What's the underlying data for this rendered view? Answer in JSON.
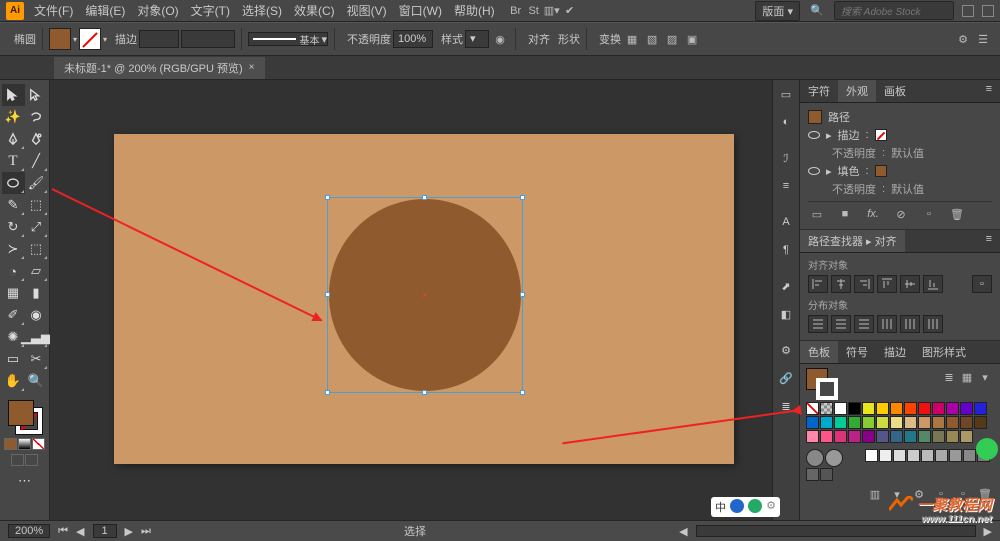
{
  "app": {
    "logo": "Ai"
  },
  "menu": {
    "file": "文件(F)",
    "edit": "编辑(E)",
    "object": "对象(O)",
    "type": "文字(T)",
    "select": "选择(S)",
    "effect": "效果(C)",
    "view": "视图(V)",
    "window": "窗口(W)",
    "help": "帮助(H)"
  },
  "topright": {
    "workspace": "版面",
    "search_placeholder": "搜索 Adobe Stock"
  },
  "control": {
    "context": "椭圆",
    "stroke_label": "描边",
    "stroke_weight": "",
    "stroke_style": "基本",
    "opacity_label": "不透明度",
    "opacity_value": "100%",
    "style_label": "样式",
    "align_label": "对齐",
    "shape_label": "形状",
    "transform_label": "变换"
  },
  "doc": {
    "tab_title": "未标题-1* @ 200% (RGB/GPU 预览)"
  },
  "panels": {
    "tabs": {
      "char": "字符",
      "appearance": "外观",
      "artboard": "画板"
    },
    "appearance": {
      "item_label": "路径",
      "stroke_label": "描边",
      "opacity_label": "不透明度",
      "default_label": "默认值",
      "fill_label": "填色"
    },
    "pathfinder": {
      "title": "路径查找器",
      "align": "对齐",
      "align_to": "对齐对象",
      "distribute": "分布对象"
    },
    "swatches": {
      "tabs": {
        "swatches": "色板",
        "symbols": "符号",
        "brushes": "描边",
        "gstyles": "图形样式"
      }
    }
  },
  "status": {
    "zoom": "200%",
    "tool": "选择"
  },
  "colors": {
    "row1": [
      "#ffffff",
      "#000000",
      "#e6e61a",
      "#ffcc00",
      "#ff8800",
      "#ff4400",
      "#ee1111",
      "#cc0066",
      "#aa00aa",
      "#6600cc",
      "#2222dd",
      "#0066cc"
    ],
    "row2": [
      "#00aacc",
      "#00cc99",
      "#33aa33",
      "#88cc33",
      "#ccdd44",
      "#eedd88",
      "#ddbb88",
      "#cc9966",
      "#aa7744",
      "#8f5a2e",
      "#704626",
      "#553719"
    ],
    "row3": [
      "#ff88aa",
      "#ff5588",
      "#dd3377",
      "#bb2288",
      "#880088",
      "#555588",
      "#336688",
      "#227788",
      "#558866",
      "#777755",
      "#998855",
      "#aa9966"
    ],
    "row4": [
      "#444444",
      "#555555",
      "#666666",
      "#777777",
      "#888888",
      "#999999",
      "#aaaaaa",
      "#ffffff",
      "#eeeeee",
      "#dddddd",
      "#cccccc",
      "#bbbbbb",
      "#aaaaaa",
      "#999999",
      "#888888",
      "#777777",
      "#666666",
      "#555555"
    ]
  },
  "watermark": {
    "text": "一聚教程网",
    "url": "www.111cn.net"
  }
}
